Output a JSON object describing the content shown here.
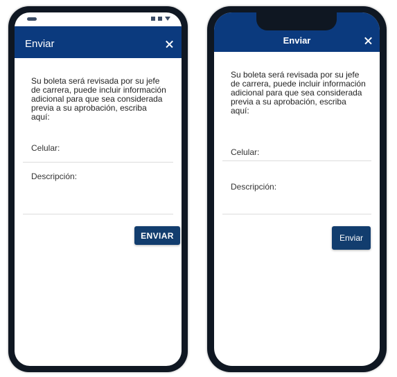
{
  "android": {
    "title": "Enviar",
    "message": "Su boleta será revisada por su jefe de carrera, puede incluir información adicional para que sea considerada previa a su aprobación, escriba aquí:",
    "phone_label": "Celular:",
    "description_label": "Descripción:",
    "submit_label": "ENVIAR"
  },
  "ios": {
    "title": "Enviar",
    "message": "Su boleta será revisada por su jefe de carrera, puede incluir información adicional para que sea considerada previa a su aprobación, escriba aquí:",
    "phone_label": "Celular:",
    "description_label": "Descripción:",
    "submit_label": "Enviar"
  },
  "colors": {
    "primary": "#0b3a7e",
    "button": "#123d6e",
    "device_frame": "#0f1722"
  },
  "icons": [
    "close-icon",
    "status-bar-icons"
  ]
}
